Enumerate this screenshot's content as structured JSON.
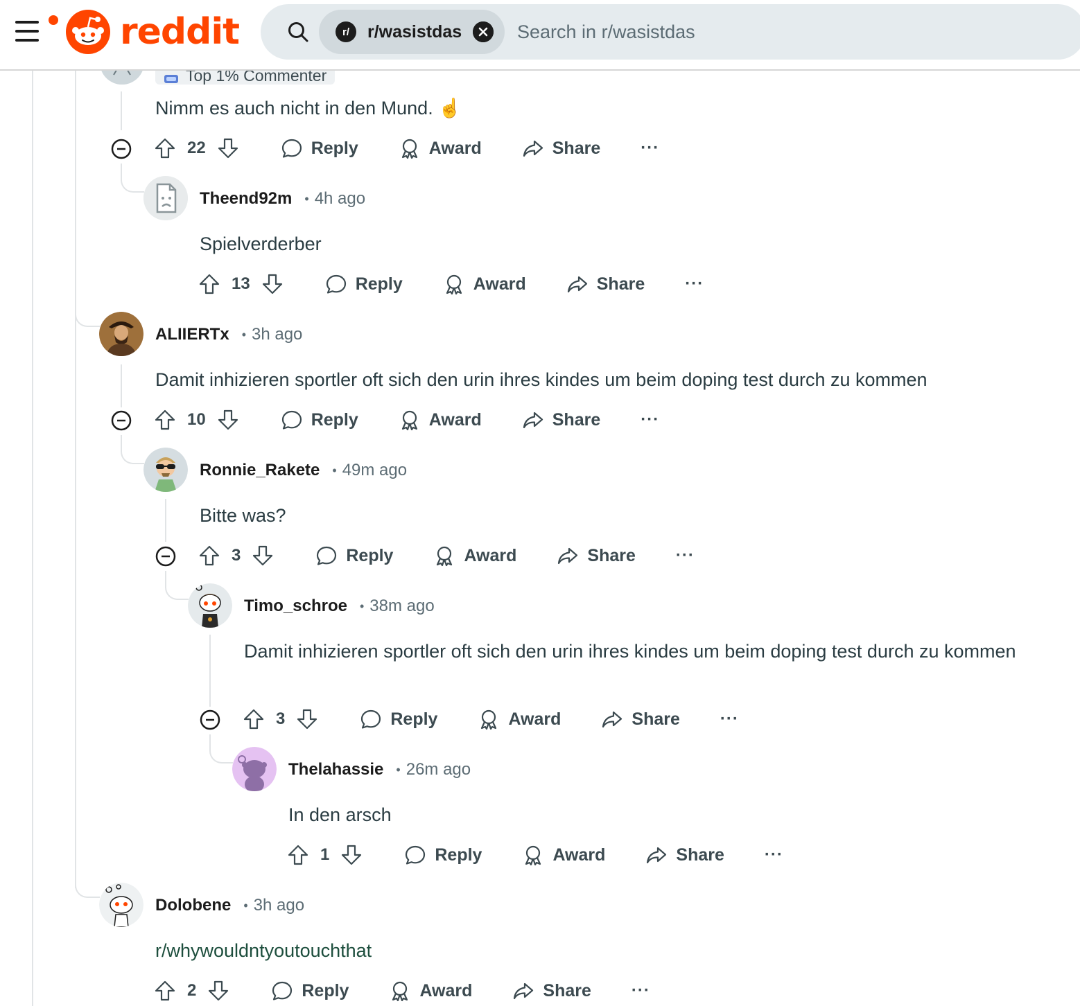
{
  "header": {
    "logo_text": "reddit",
    "search_chip": "r/wasistdas",
    "search_chip_badge": "r/",
    "search_placeholder": "Search in r/wasistdas"
  },
  "colors": {
    "brand": "#ff4500",
    "line": "#e1e4e6",
    "muted": "#5c6c74"
  },
  "labels": {
    "reply": "Reply",
    "award": "Award",
    "share": "Share",
    "more": "···"
  },
  "comments": [
    {
      "flair": "Top 1% Commenter",
      "body": "Nimm es auch nicht in den Mund. ☝️",
      "votes": "22"
    },
    {
      "username": "Theend92m",
      "time": "4h ago",
      "body": "Spielverderber",
      "votes": "13"
    },
    {
      "username": "ALIIERTx",
      "time": "3h ago",
      "body": "Damit inhizieren sportler oft sich den urin ihres kindes um beim doping test durch zu kommen",
      "votes": "10"
    },
    {
      "username": "Ronnie_Rakete",
      "time": "49m ago",
      "body": "Bitte was?",
      "votes": "3"
    },
    {
      "username": "Timo_schroe",
      "time": "38m ago",
      "body": "Damit inhizieren sportler oft sich den urin ihres kindes um beim doping test durch zu kommen",
      "votes": "3"
    },
    {
      "username": "Thelahassie",
      "time": "26m ago",
      "body": "In den arsch",
      "votes": "1"
    },
    {
      "username": "Dolobene",
      "time": "3h ago",
      "body": "r/whywouldntyoutouchthat",
      "votes": "2"
    }
  ]
}
